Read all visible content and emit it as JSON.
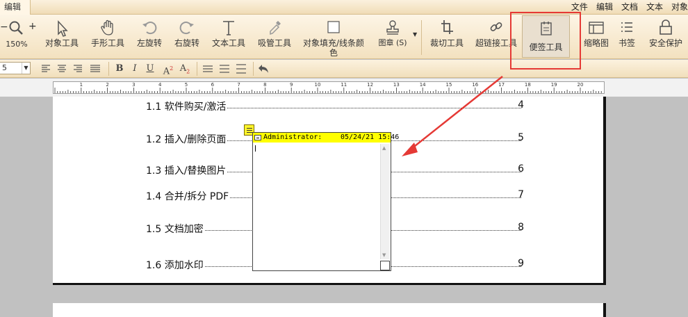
{
  "topbar": {
    "active_tab": "编辑",
    "menus": [
      "文件",
      "编辑",
      "文档",
      "文本",
      "对象"
    ]
  },
  "ribbon": {
    "zoom": {
      "minus": "−",
      "plus": "+",
      "value": "150%"
    },
    "tools": [
      {
        "name": "object-tool",
        "label": "对象工具",
        "icon": "cursor-arrow-icon"
      },
      {
        "name": "hand-tool",
        "label": "手形工具",
        "icon": "hand-icon"
      },
      {
        "name": "rotate-left",
        "label": "左旋转",
        "icon": "rotate-left-icon"
      },
      {
        "name": "rotate-right",
        "label": "右旋转",
        "icon": "rotate-right-icon"
      },
      {
        "name": "text-tool",
        "label": "文本工具",
        "icon": "text-t-icon"
      },
      {
        "name": "eyedropper",
        "label": "吸管工具",
        "icon": "eyedropper-icon"
      },
      {
        "name": "fill-stroke",
        "label": "对象填充/线条颜色",
        "icon": "color-swatch-icon"
      },
      {
        "name": "stamp",
        "label": "图章 (S)",
        "icon": "stamp-icon"
      },
      {
        "name": "crop",
        "label": "裁切工具",
        "icon": "crop-icon"
      },
      {
        "name": "hyperlink",
        "label": "超链接工具",
        "icon": "link-icon"
      },
      {
        "name": "note",
        "label": "便签工具",
        "icon": "note-icon"
      },
      {
        "name": "thumbnail",
        "label": "缩略图",
        "icon": "thumbnail-icon"
      },
      {
        "name": "bookmark",
        "label": "书签",
        "icon": "bookmark-list-icon"
      },
      {
        "name": "security",
        "label": "安全保护",
        "icon": "lock-icon"
      }
    ]
  },
  "format": {
    "font_size": "5",
    "bold": "B",
    "italic": "I",
    "underline": "U",
    "superscript": "A",
    "sup_mark": "2",
    "subscript": "A",
    "sub_mark": "2"
  },
  "ruler": {
    "numbers": [
      "1",
      "2",
      "3",
      "4",
      "5",
      "6",
      "7",
      "8",
      "9",
      "10",
      "11",
      "12",
      "13",
      "14",
      "15",
      "16",
      "17",
      "18",
      "19",
      "20"
    ]
  },
  "toc": [
    {
      "title": "1.1 软件购买/激活",
      "page": "4"
    },
    {
      "title": "1.2 插入/删除页面",
      "page": "5"
    },
    {
      "title": "1.3 插入/替换图片",
      "page": "6"
    },
    {
      "title": "1.4 合并/拆分 PDF",
      "page": "7"
    },
    {
      "title": "1.5 文档加密",
      "page": "8"
    },
    {
      "title": "1.6 添加水印",
      "page": "9"
    }
  ],
  "note_popup": {
    "author": "Administrator:",
    "date": "05/24/21 15:46"
  },
  "colors": {
    "highlight_box": "#e53935",
    "note_header": "#ffff00",
    "ribbon_bg": "#f3e1bf"
  }
}
